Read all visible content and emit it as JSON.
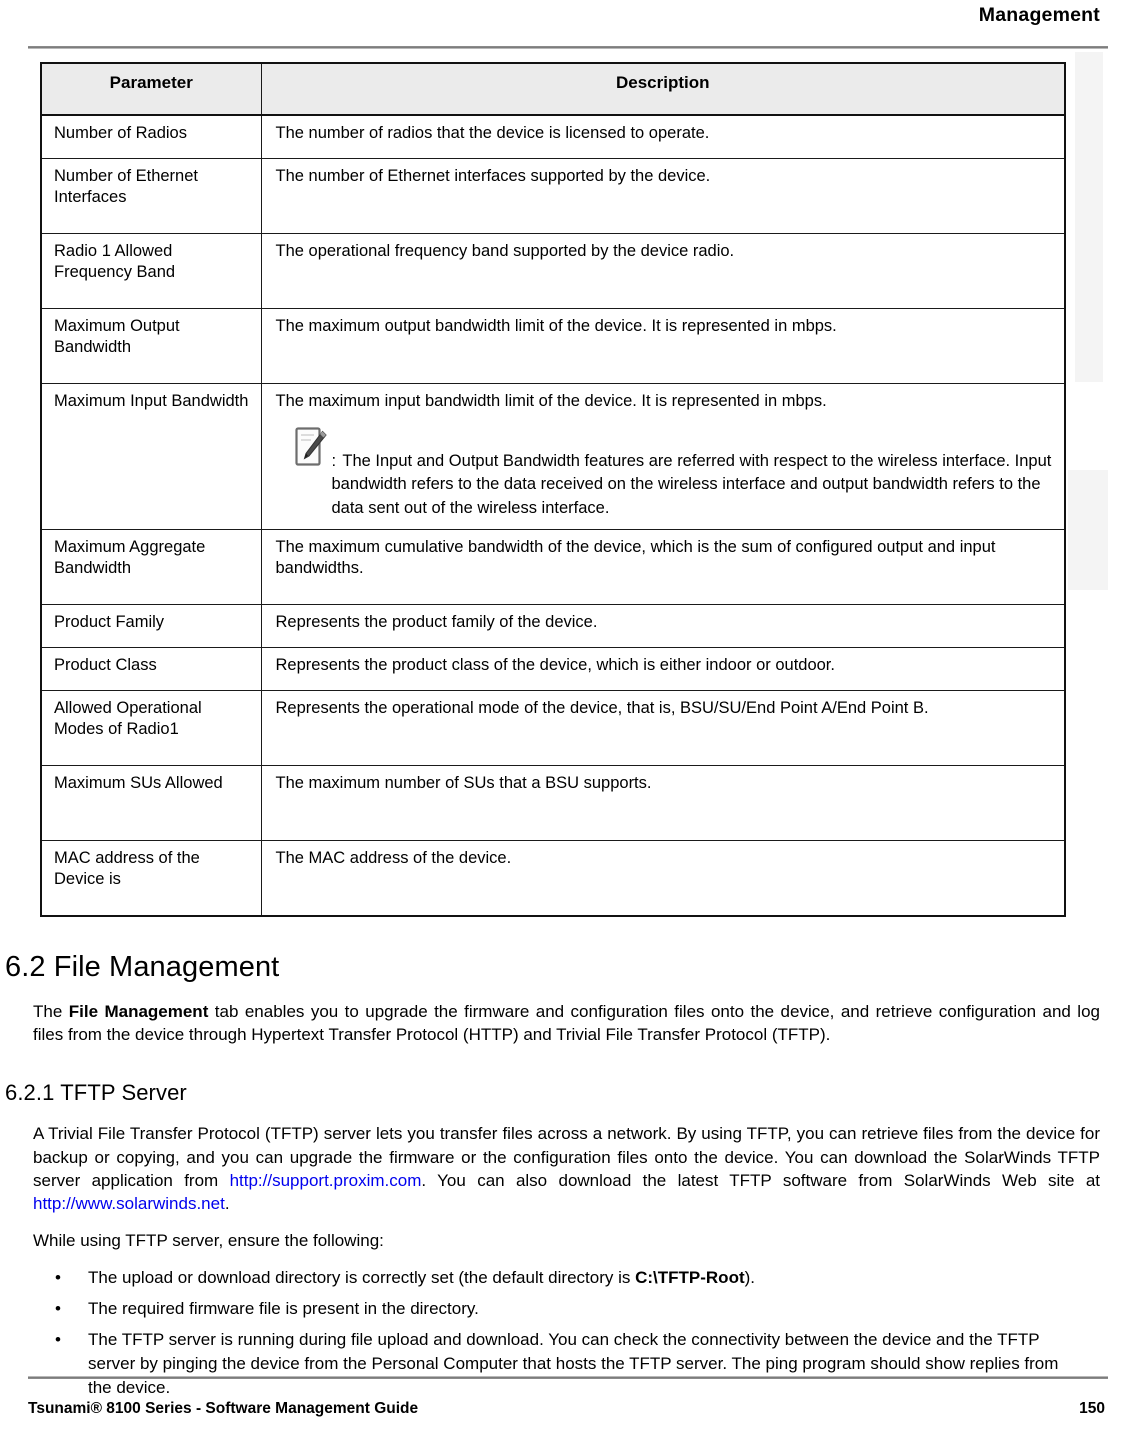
{
  "header": {
    "running_head": "Management"
  },
  "table": {
    "columns": [
      "Parameter",
      "Description"
    ],
    "rows": [
      {
        "parameter": "Number of Radios",
        "description": "The number of radios that the device is licensed to operate."
      },
      {
        "parameter": "Number of Ethernet Interfaces",
        "description": "The number of Ethernet interfaces supported by the device."
      },
      {
        "parameter": "Radio 1 Allowed Frequency Band",
        "description": "The operational frequency band supported by the device radio."
      },
      {
        "parameter": "Maximum Output Bandwidth",
        "description": "The maximum output bandwidth limit of the device. It is represented in mbps."
      },
      {
        "parameter": "Maximum Input Bandwidth",
        "description": "The maximum input bandwidth limit of the device. It is represented in mbps.",
        "note": {
          "icon": "note-pencil-icon",
          "prefix": ":",
          "text": "The Input and Output Bandwidth features are referred with respect to the wireless interface. Input bandwidth refers to the data received on the wireless interface and output bandwidth refers to the data sent out of the wireless interface."
        }
      },
      {
        "parameter": "Maximum Aggregate Bandwidth",
        "description": "The maximum cumulative bandwidth of the device, which is the sum of configured output and input bandwidths."
      },
      {
        "parameter": "Product Family",
        "description": "Represents the product family of the device."
      },
      {
        "parameter": "Product Class",
        "description": "Represents the product class of the device, which is either indoor or outdoor."
      },
      {
        "parameter": "Allowed Operational Modes of Radio1",
        "description": "Represents the operational mode of the device, that is, BSU/SU/End Point A/End Point B."
      },
      {
        "parameter": "Maximum SUs Allowed",
        "description": "The maximum number of SUs that a BSU supports."
      },
      {
        "parameter": "MAC address of the Device is",
        "description": "The MAC address of the device."
      }
    ]
  },
  "section": {
    "title": "6.2 File Management",
    "intro_part1": "The ",
    "intro_bold": "File Management",
    "intro_part2": " tab enables you to upgrade the firmware and configuration files onto the device, and retrieve configuration and log files from the device through Hypertext Transfer Protocol (HTTP) and Trivial File Transfer Protocol (TFTP)."
  },
  "subsection": {
    "title": "6.2.1 TFTP Server",
    "para_part1": "A Trivial File Transfer Protocol (TFTP) server lets you transfer files across a network. By using TFTP, you can retrieve files from the device for backup or copying, and you can upgrade the firmware or the configuration files onto the device. You can download the SolarWinds TFTP server application from ",
    "link1": "http://support.proxim.com",
    "para_part2": ". You can also download the latest TFTP software from SolarWinds Web site at ",
    "link2": "http://www.solarwinds.net",
    "para_part3": ".",
    "lead_in": "While using TFTP server, ensure the following:",
    "bullet_marker": "•",
    "bullets": [
      {
        "text_before": "The upload or download directory is correctly set (the default directory is ",
        "bold": "C:\\TFTP-Root",
        "text_after": ")."
      },
      {
        "text_before": "The required firmware file is present in the directory.",
        "bold": "",
        "text_after": ""
      },
      {
        "text_before": "The TFTP server is running during file upload and download. You can check the connectivity between the device and the TFTP server by pinging the device from the Personal Computer that hosts the TFTP server. The ping program should show replies from the device.",
        "bold": "",
        "text_after": ""
      }
    ]
  },
  "footer": {
    "guide_title": "Tsunami® 8100 Series - Software Management Guide",
    "page_number": "150"
  },
  "colors": {
    "link": "#0000ee",
    "table_header_bg": "#ebebeb",
    "rule": "#6e6e6e",
    "text": "#000000"
  }
}
